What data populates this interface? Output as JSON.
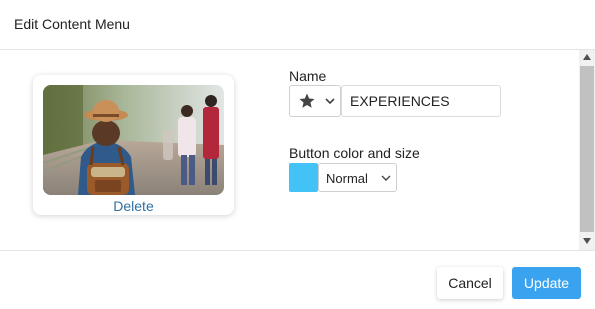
{
  "dialog": {
    "title": "Edit Content Menu"
  },
  "image_card": {
    "delete_label": "Delete",
    "photo_icon": "traveler-photo"
  },
  "name_field": {
    "label": "Name",
    "icon": "star-icon",
    "value": "EXPERIENCES"
  },
  "button_style": {
    "label": "Button color and size",
    "color": "#42c2f7",
    "size_value": "Normal"
  },
  "footer": {
    "cancel_label": "Cancel",
    "update_label": "Update"
  },
  "colors": {
    "accent": "#3aa3f0",
    "link": "#2f6fa3"
  }
}
